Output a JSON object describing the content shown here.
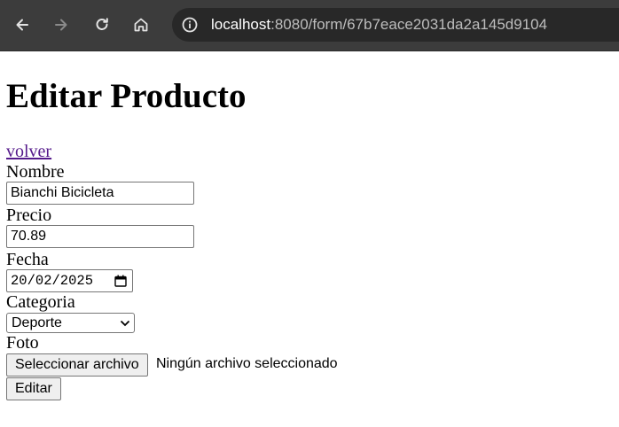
{
  "browser": {
    "url_host": "localhost",
    "url_rest": ":8080/form/67b7eace2031da2a145d9104",
    "icons": [
      "back-arrow-icon",
      "forward-arrow-icon",
      "reload-icon",
      "home-icon",
      "info-icon"
    ]
  },
  "page": {
    "title": "Editar Producto",
    "back_link": "volver"
  },
  "form": {
    "nombre_label": "Nombre",
    "nombre_value": "Bianchi Bicicleta",
    "precio_label": "Precio",
    "precio_value": "70.89",
    "fecha_label": "Fecha",
    "fecha_value": "20/02/2025",
    "categoria_label": "Categoria",
    "categoria_value": "Deporte",
    "foto_label": "Foto",
    "file_button": "Seleccionar archivo",
    "file_status": "Ningún archivo seleccionado",
    "submit_label": "Editar"
  },
  "colors": {
    "chrome": "#3c3c3c",
    "omnibox": "#282828",
    "link": "#551a8b"
  }
}
